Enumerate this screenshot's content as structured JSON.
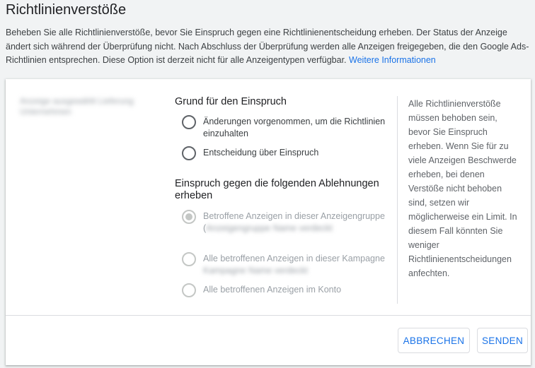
{
  "page": {
    "title": "Richtlinienverstöße",
    "intro_text": "Beheben Sie alle Richtlinienverstöße, bevor Sie Einspruch gegen eine Richtlinienentscheidung erheben. Der Status der Anzeige ändert sich während der Überprüfung nicht. Nach Abschluss der Überprüfung werden alle Anzeigen freigegeben, die den Google Ads-Richtlinien entsprechen. Diese Option ist derzeit nicht für alle Anzeigentypen verfügbar.",
    "learn_more_link": "Weitere Informationen"
  },
  "card": {
    "blurred_name": "Anzeige ausgewählt Lieferung Unternehmen",
    "reason": {
      "heading": "Grund für den Einspruch",
      "options": [
        {
          "label": "Änderungen vorgenommen, um die Richtlinien einzuhalten",
          "checked": false,
          "disabled": false
        },
        {
          "label": "Entscheidung über Einspruch",
          "checked": false,
          "disabled": false
        }
      ]
    },
    "scope": {
      "heading": "Einspruch gegen die folgenden Ablehnungen erheben",
      "options": [
        {
          "label": "Betroffene Anzeigen in dieser Anzeigengruppe (",
          "blurred_suffix": "Anzeigengruppe Name verdeckt",
          "checked": true,
          "disabled": true
        },
        {
          "label": "Alle betroffenen Anzeigen in dieser Kampagne",
          "blurred_suffix": "Kampagne Name verdeckt",
          "checked": false,
          "disabled": true
        },
        {
          "label": "Alle betroffenen Anzeigen im Konto",
          "checked": false,
          "disabled": true
        }
      ]
    },
    "side_note": "Alle Richtlinienverstöße müssen behoben sein, bevor Sie Einspruch erheben. Wenn Sie für zu viele Anzeigen Beschwerde erheben, bei denen Verstöße nicht behoben sind, setzen wir möglicherweise ein Limit. In diesem Fall könnten Sie weniger Richtlinienentscheidungen anfechten.",
    "buttons": {
      "cancel": "ABBRECHEN",
      "send": "SENDEN"
    }
  },
  "colors": {
    "accent": "#1a73e8",
    "background": "#f1f3f4",
    "card": "#ffffff",
    "disabled": "#c4c7c5"
  }
}
